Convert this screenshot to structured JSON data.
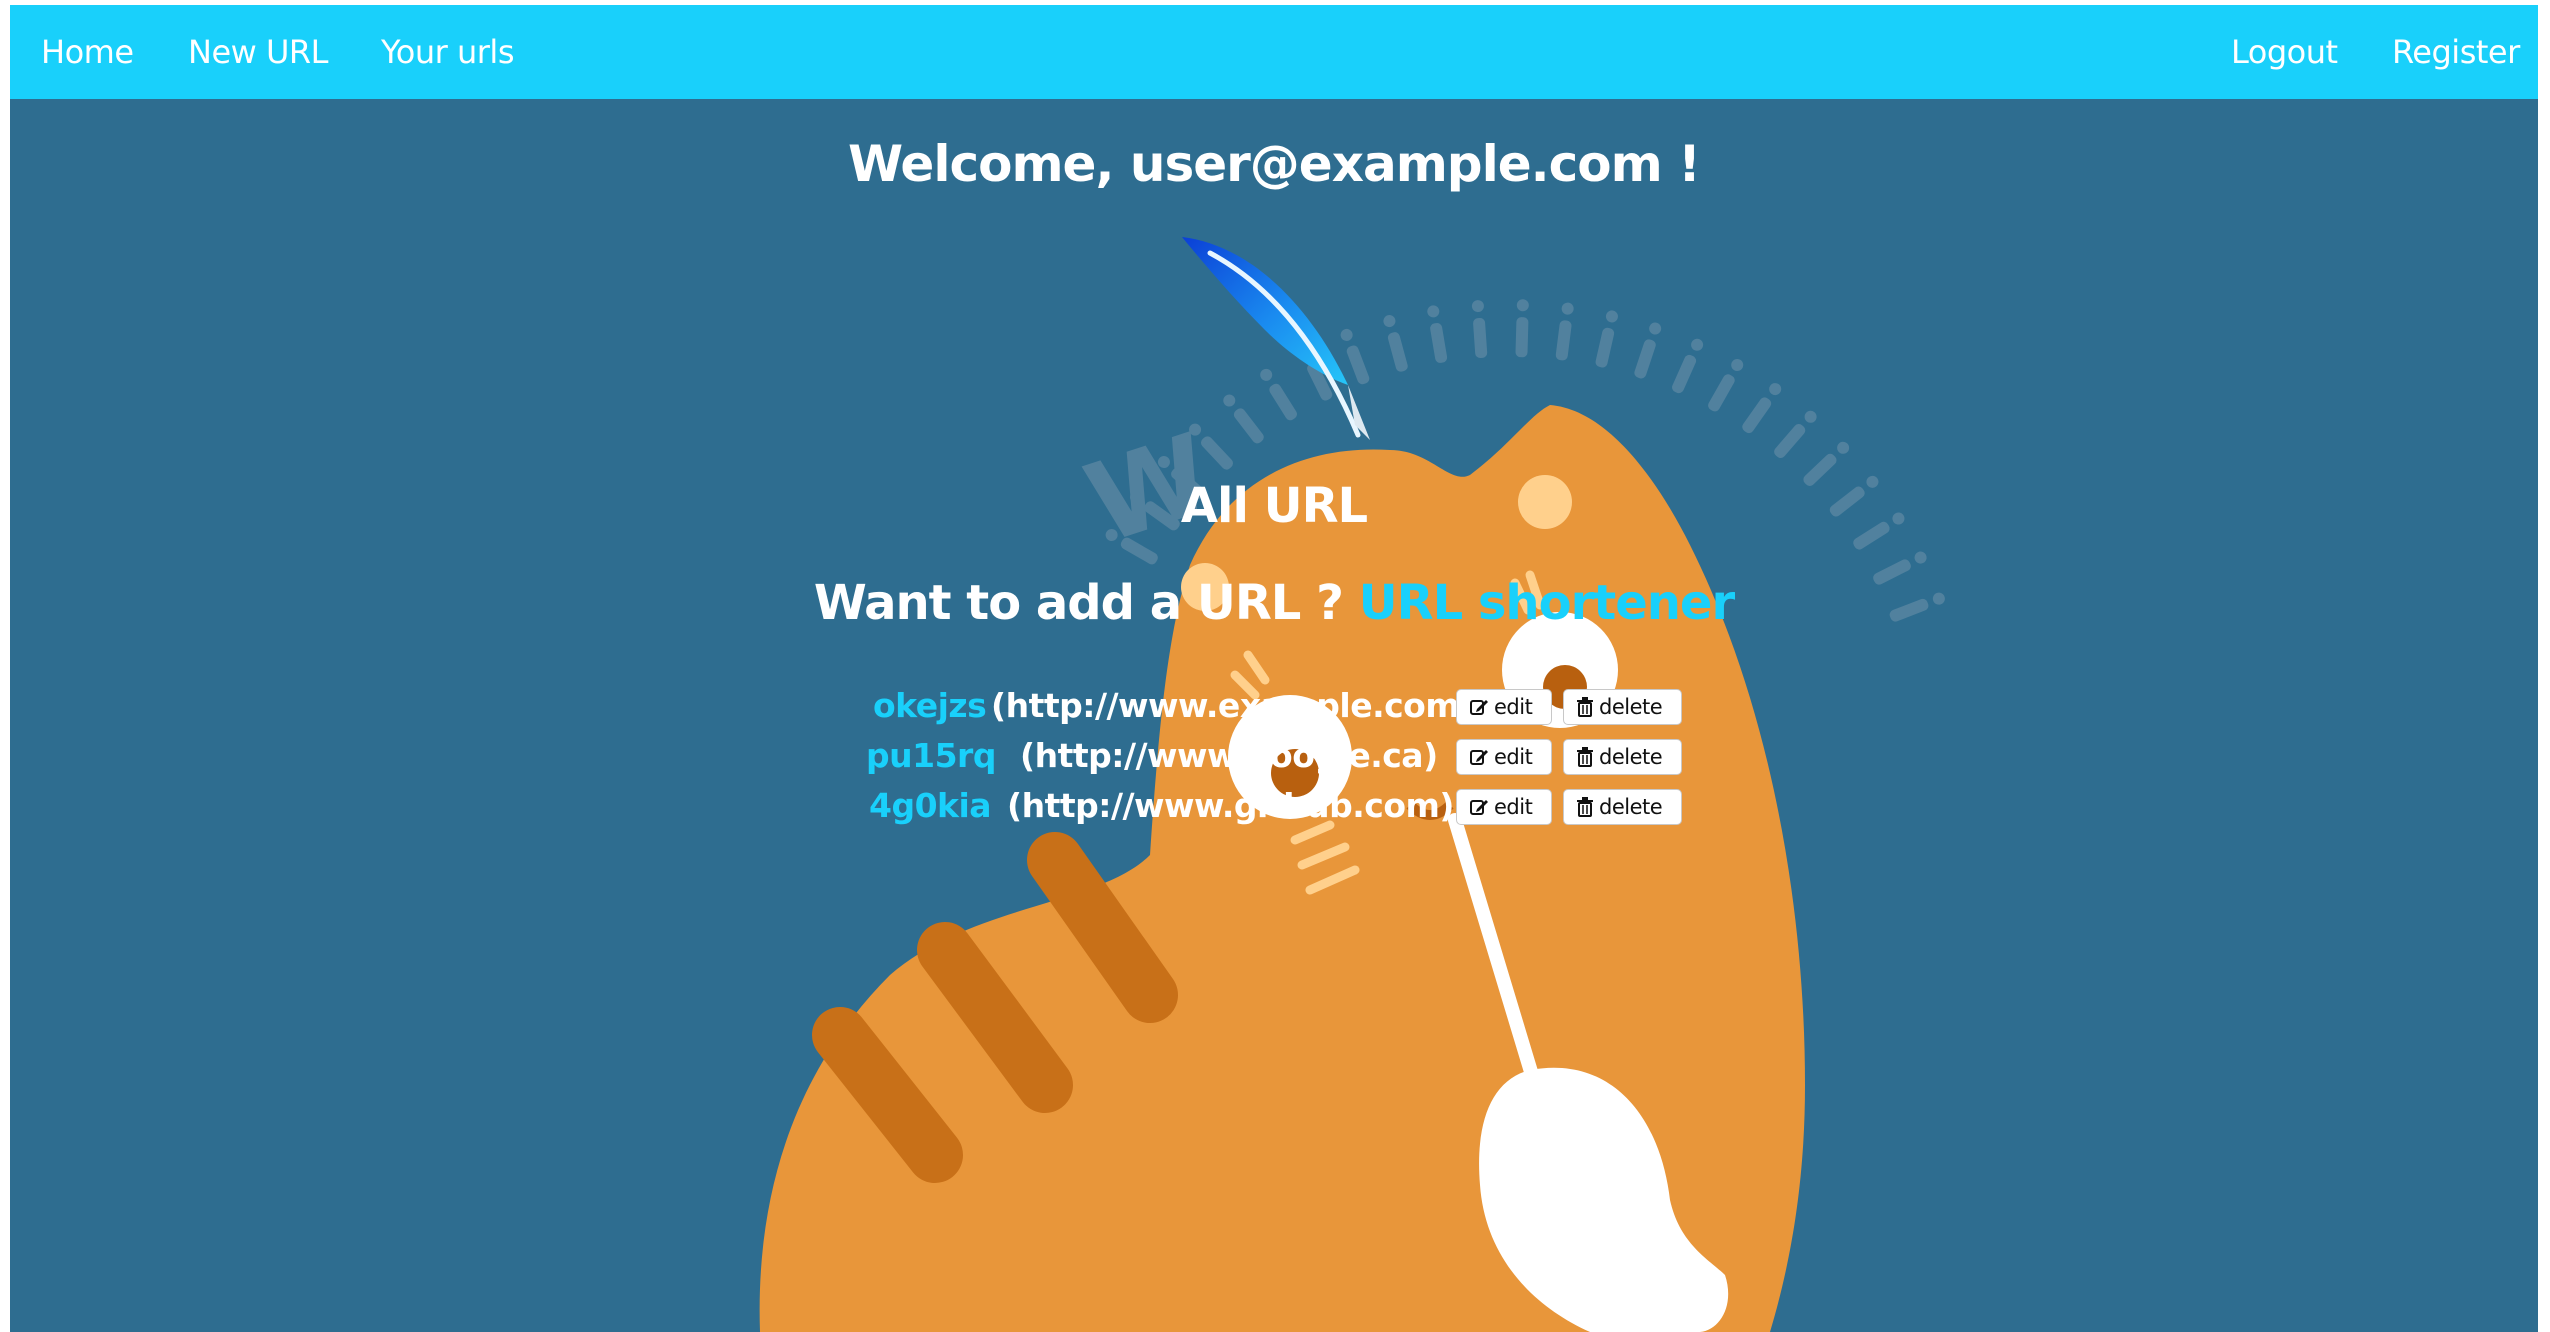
{
  "navbar": {
    "home": "Home",
    "new_url": "New URL",
    "your_urls": "Your urls",
    "logout": "Logout",
    "register": "Register"
  },
  "welcome": "Welcome, user@example.com !",
  "heading": "All URL",
  "add_prompt": {
    "text": "Want to add a URL ? ",
    "link": "URL shortener"
  },
  "urls": [
    {
      "short": "okejzs",
      "long": "(http://www.example.com)",
      "edit": "edit",
      "delete": "delete"
    },
    {
      "short": "pu15rq",
      "long": "(http://www.google.ca)",
      "edit": "edit",
      "delete": "delete"
    },
    {
      "short": "4g0kia",
      "long": "(http://www.github.com)",
      "edit": "edit",
      "delete": "delete"
    }
  ],
  "colors": {
    "background": "#2e6d90",
    "navbar": "#19d0fb",
    "accent": "#19d0fb",
    "cat": "#e8963a",
    "stripes": "#c87018"
  },
  "icons": {
    "logo": "feather-logo",
    "edit": "edit-icon",
    "delete": "trash-icon"
  }
}
